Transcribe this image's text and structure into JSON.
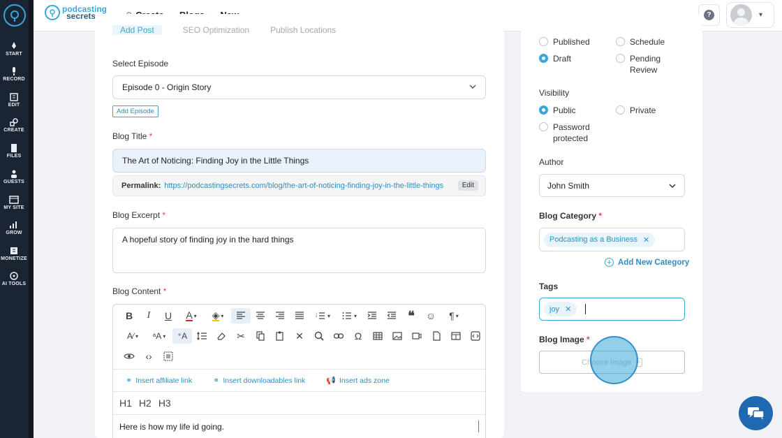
{
  "rail": {
    "items": [
      {
        "label": "START",
        "icon": "rocket-icon"
      },
      {
        "label": "RECORD",
        "icon": "microphone-icon"
      },
      {
        "label": "EDIT",
        "icon": "edit-icon"
      },
      {
        "label": "CREATE",
        "icon": "create-icon"
      },
      {
        "label": "FILES",
        "icon": "files-icon"
      },
      {
        "label": "GUESTS",
        "icon": "guests-icon"
      },
      {
        "label": "MY SITE",
        "icon": "site-icon"
      },
      {
        "label": "GROW",
        "icon": "chart-icon"
      },
      {
        "label": "MONETIZE",
        "icon": "monetize-icon"
      },
      {
        "label": "AI TOOLS",
        "icon": "ai-icon"
      }
    ]
  },
  "header": {
    "brand_line1": "podcasting",
    "brand_line2": "secrets",
    "crumbs": [
      "Create",
      "Blogs",
      "New"
    ]
  },
  "main": {
    "tabs": [
      "Add Post",
      "SEO Optimization",
      "Publish Locations"
    ],
    "episode_label": "Select Episode",
    "episode_value": "Episode 0 - Origin Story",
    "add_episode": "Add Episode",
    "title_label": "Blog Title",
    "title_value": "The Art of Noticing: Finding Joy in the Little Things",
    "permalink_label": "Permalink:",
    "permalink_url": "https://podcastingsecrets.com/blog/the-art-of-noticing-finding-joy-in-the-little-things",
    "permalink_edit": "Edit",
    "excerpt_label": "Blog Excerpt",
    "excerpt_value": "A hopeful story of finding joy in the hard things",
    "content_label": "Blog Content",
    "required_mark": "*",
    "insert_affiliate": "Insert affiliate link",
    "insert_downloadables": "Insert downloadables link",
    "insert_ads": "Insert ads zone",
    "headings": [
      "H1",
      "H2",
      "H3"
    ],
    "content_text": "Here is how my life id going."
  },
  "side": {
    "status_options": [
      "Published",
      "Schedule",
      "Draft",
      "Pending",
      "Review"
    ],
    "visibility_label": "Visibility",
    "visibility_options": [
      "Public",
      "Private",
      "Password",
      "protected"
    ],
    "author_label": "Author",
    "author_value": "John Smith",
    "category_label": "Blog Category",
    "category_chip": "Podcasting as a Business",
    "add_category": "Add New Category",
    "tags_label": "Tags",
    "tag_chip": "joy",
    "image_label": "Blog Image",
    "choose_image": "Choose Image"
  },
  "colors": {
    "accent": "#3aa7d8",
    "rail": "#1b2433",
    "chat": "#1f68b2"
  }
}
